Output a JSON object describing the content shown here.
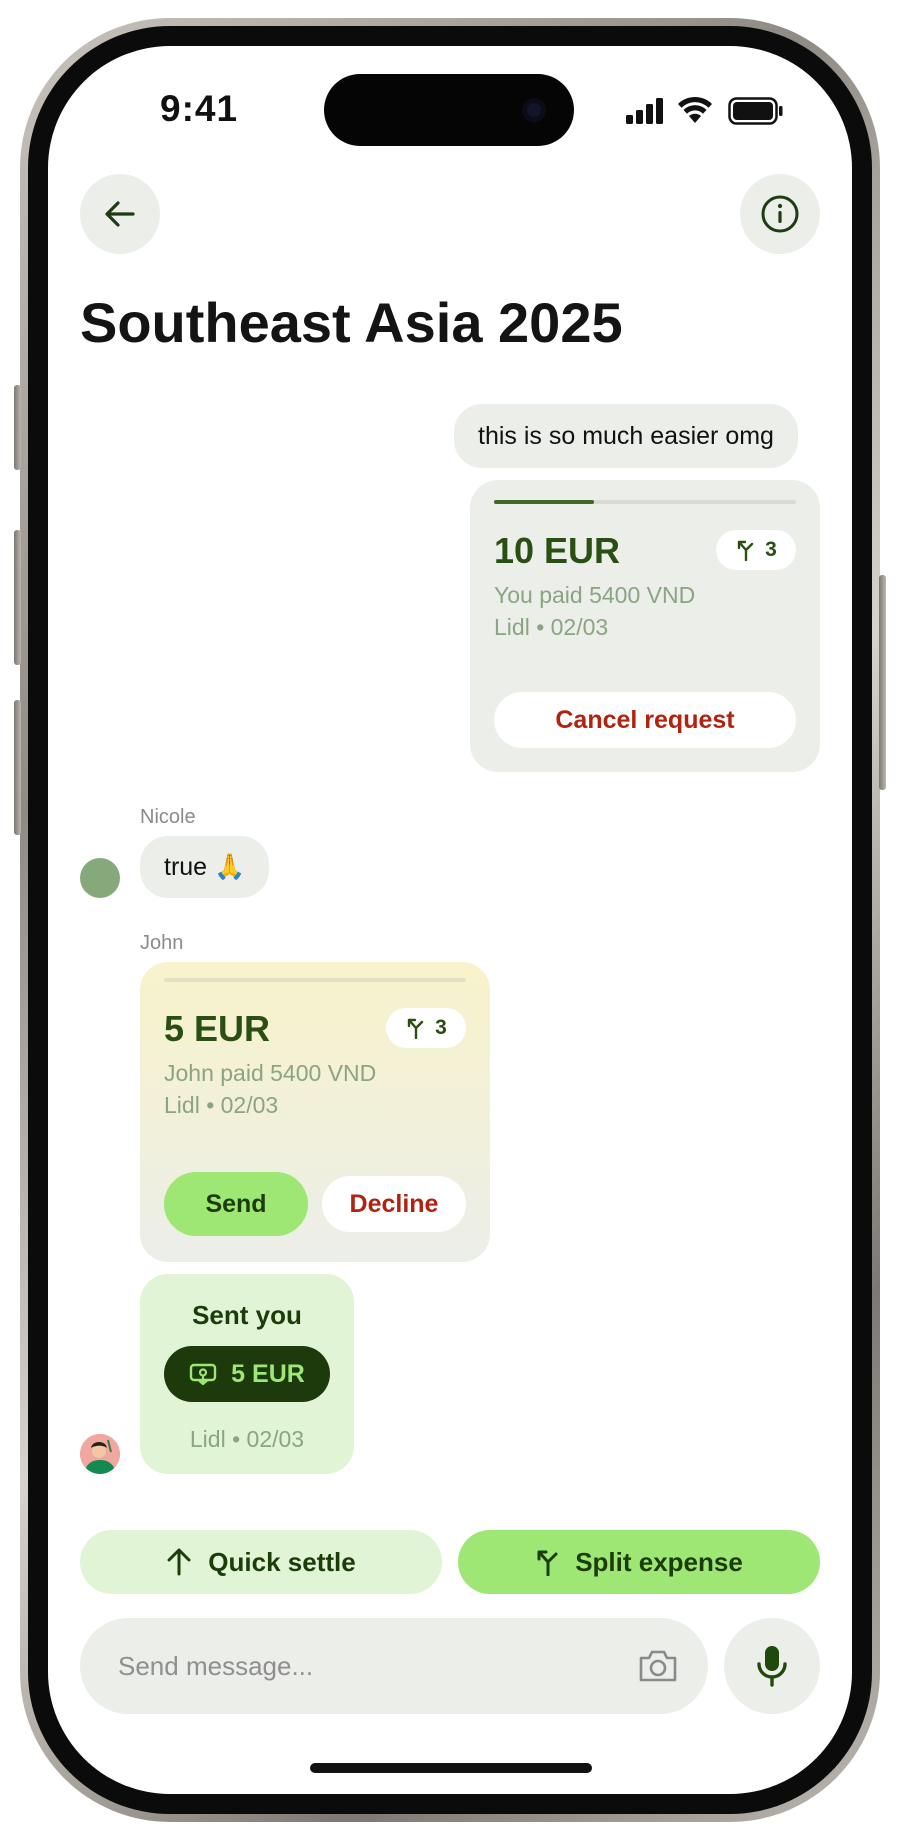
{
  "status_bar": {
    "time": "9:41"
  },
  "header": {
    "title": "Southeast Asia 2025"
  },
  "messages": {
    "my_text": "this is so much easier omg",
    "my_request": {
      "amount": "10 EUR",
      "split_count": "3",
      "paid_line": "You paid 5400 VND",
      "meta_line": "Lidl • 02/03",
      "progress_fraction": 0.33,
      "cancel_label": "Cancel request"
    },
    "nicole": {
      "name": "Nicole",
      "text": "true 🙏"
    },
    "john_request": {
      "name": "John",
      "amount": "5 EUR",
      "split_count": "3",
      "paid_line": "John paid 5400 VND",
      "meta_line": "Lidl • 02/03",
      "send_label": "Send",
      "decline_label": "Decline"
    },
    "john_payment": {
      "title": "Sent you",
      "amount": "5 EUR",
      "meta_line": "Lidl • 02/03"
    }
  },
  "actions": {
    "quick_settle_label": "Quick settle",
    "split_expense_label": "Split expense"
  },
  "composer": {
    "placeholder": "Send message..."
  },
  "colors": {
    "accent_green": "#9ee774",
    "light_green": "#e1f4d6",
    "dark_green": "#1c3d0a",
    "danger_red": "#b0230f",
    "bubble_gray": "#eceeea"
  }
}
